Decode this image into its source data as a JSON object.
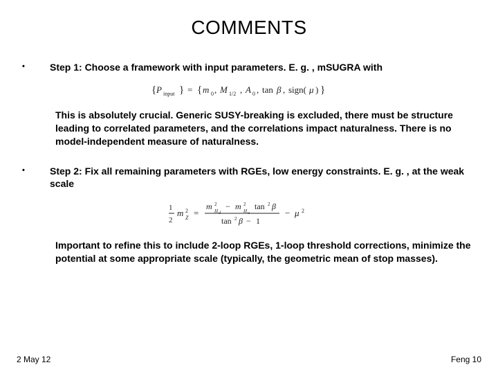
{
  "title": "COMMENTS",
  "bullets": {
    "step1": "Step 1: Choose a framework with input parameters.  E. g. , mSUGRA with",
    "step2": "Step 2: Fix all remaining parameters with RGEs, low energy constraints.  E. g. , at the weak scale"
  },
  "equations": {
    "eq1_tex": "\\{P_{\\mathrm{input}}\\} = \\{ m_0, M_{1/2}, A_0, \\tan\\beta, \\mathrm{sign}(\\mu) \\}",
    "eq2_tex": "\\tfrac{1}{2} m_Z^2 = \\dfrac{m_{H_d}^2 - m_{H_u}^2 \\tan^2\\beta}{\\tan^2\\beta - 1} - \\mu^2"
  },
  "paragraphs": {
    "p1": "This is absolutely crucial.  Generic SUSY-breaking is excluded, there must be structure leading to correlated parameters, and the correlations impact naturalness.  There is no model-independent measure of naturalness.",
    "p2": "Important to refine this to include 2-loop RGEs, 1-loop threshold corrections, minimize the potential at some appropriate scale (typically, the geometric mean of stop masses)."
  },
  "footer": {
    "date": "2 May 12",
    "attribution": "Feng 10"
  }
}
